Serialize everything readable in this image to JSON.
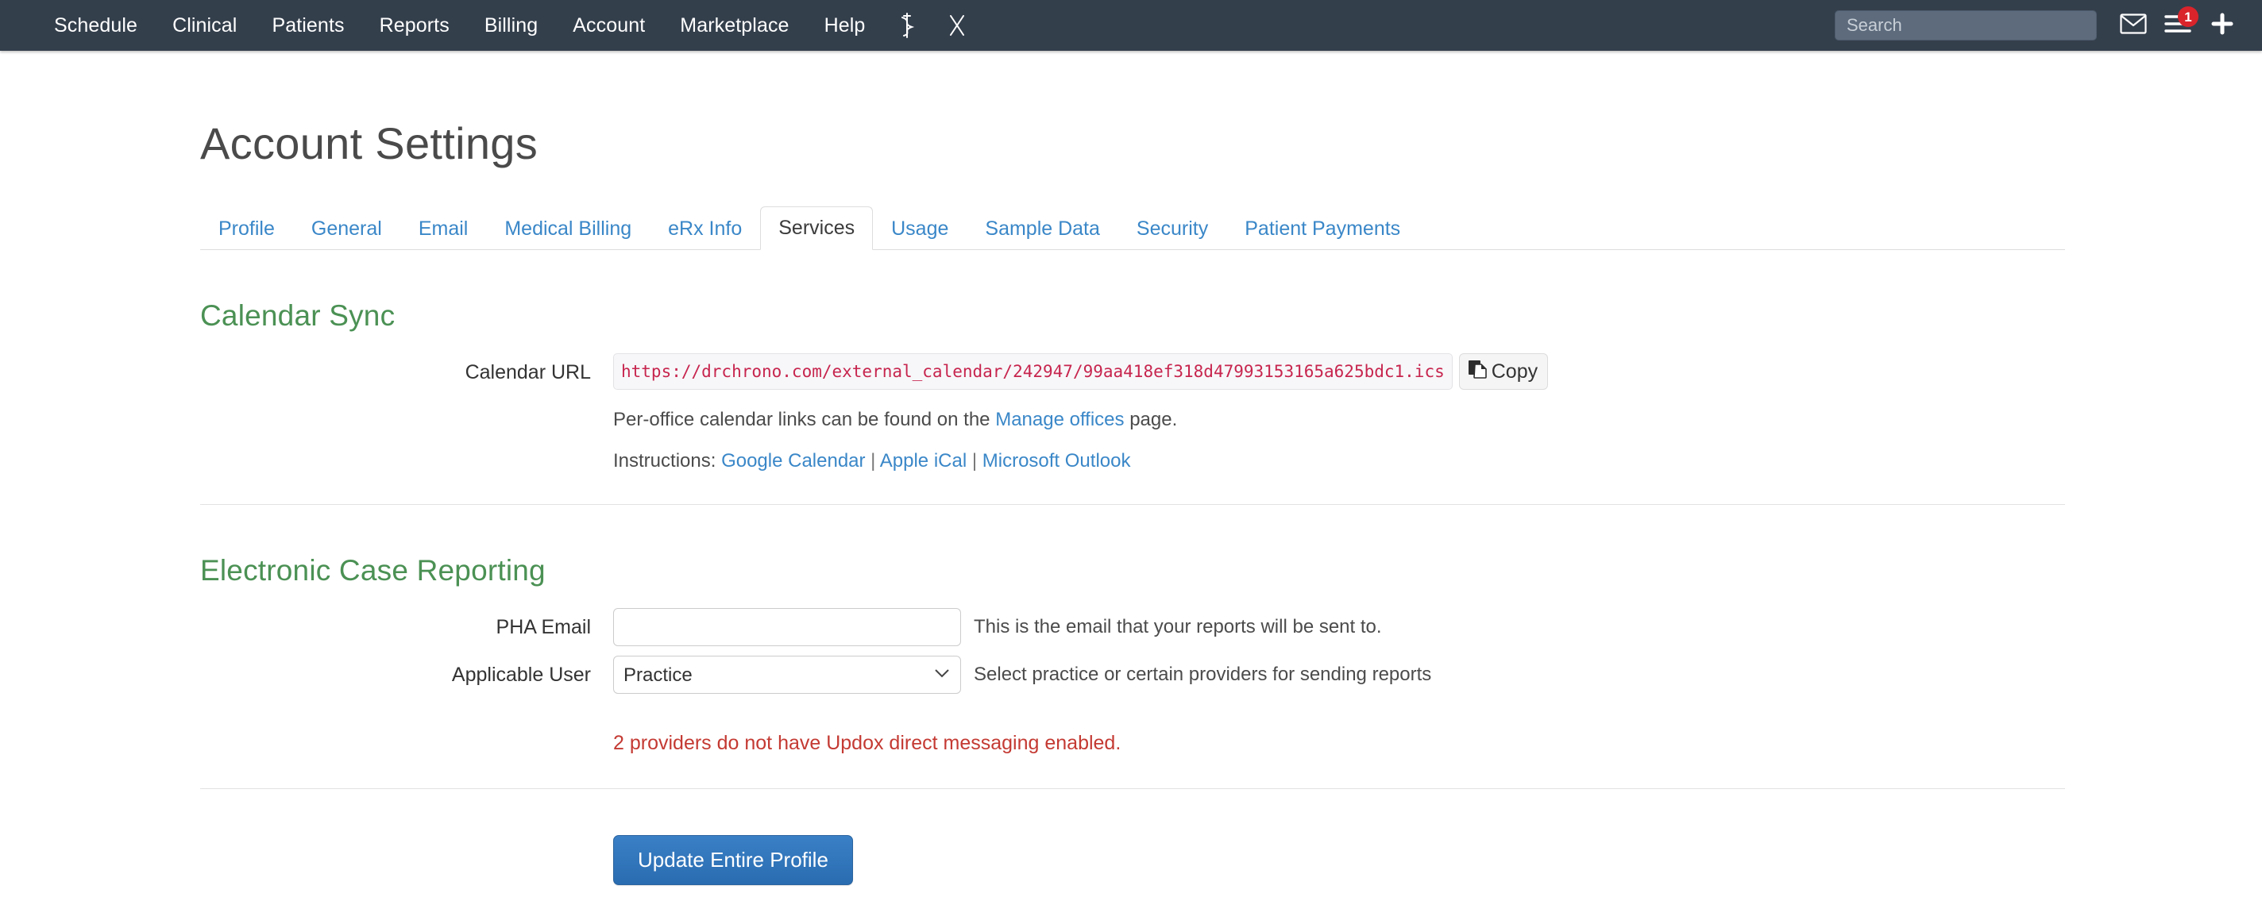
{
  "navbar": {
    "links": [
      {
        "label": "Schedule",
        "name": "nav-link-schedule"
      },
      {
        "label": "Clinical",
        "name": "nav-link-clinical"
      },
      {
        "label": "Patients",
        "name": "nav-link-patients"
      },
      {
        "label": "Reports",
        "name": "nav-link-reports"
      },
      {
        "label": "Billing",
        "name": "nav-link-billing"
      },
      {
        "label": "Account",
        "name": "nav-link-account"
      },
      {
        "label": "Marketplace",
        "name": "nav-link-marketplace"
      },
      {
        "label": "Help",
        "name": "nav-link-help"
      }
    ],
    "icons": [
      {
        "name": "caduceus-icon"
      },
      {
        "name": "scissors-icon"
      }
    ],
    "search": {
      "placeholder": "Search",
      "value": ""
    },
    "mail_icon": "envelope-icon",
    "menu_icon": "hamburger-menu-icon",
    "notification_count": "1",
    "add_icon": "plus-icon",
    "bg_color": "#343f4c",
    "search_bg_color": "#5d6b7d",
    "badge_color": "#d9242b"
  },
  "header": {
    "title": "Account Settings"
  },
  "tabs": [
    {
      "label": "Profile",
      "active": false
    },
    {
      "label": "General",
      "active": false
    },
    {
      "label": "Email",
      "active": false
    },
    {
      "label": "Medical Billing",
      "active": false
    },
    {
      "label": "eRx Info",
      "active": false
    },
    {
      "label": "Services",
      "active": true
    },
    {
      "label": "Usage",
      "active": false
    },
    {
      "label": "Sample Data",
      "active": false
    },
    {
      "label": "Security",
      "active": false
    },
    {
      "label": "Patient Payments",
      "active": false
    }
  ],
  "calendar_sync": {
    "heading": "Calendar Sync",
    "url_label": "Calendar URL",
    "url_value": "https://drchrono.com/external_calendar/242947/99aa418ef318d47993153165a625bdc1.ics",
    "copy_button": "Copy",
    "copy_icon": "copy-icon",
    "note_prefix": "Per-office calendar links can be found on the ",
    "note_link": "Manage offices",
    "note_suffix": " page.",
    "instructions_label": "Instructions: ",
    "instruction_links": [
      "Google Calendar",
      "Apple iCal",
      "Microsoft Outlook"
    ],
    "separator": " | ",
    "heading_color": "#4b9154",
    "url_text_color": "#c7254e"
  },
  "electronic_case_reporting": {
    "heading": "Electronic Case Reporting",
    "pha_email_label": "PHA Email",
    "pha_email_value": "",
    "pha_email_placeholder": "",
    "pha_email_help": "This is the email that your reports will be sent to.",
    "applicable_user_label": "Applicable User",
    "applicable_user_value": "Practice",
    "applicable_user_options": [
      "Practice"
    ],
    "applicable_user_help": "Select practice or certain providers for sending reports",
    "warning": "2 providers do not have Updox direct messaging enabled.",
    "warning_color": "#c43a33"
  },
  "footer": {
    "update_button": "Update Entire Profile",
    "button_color": "#2f73ba"
  }
}
